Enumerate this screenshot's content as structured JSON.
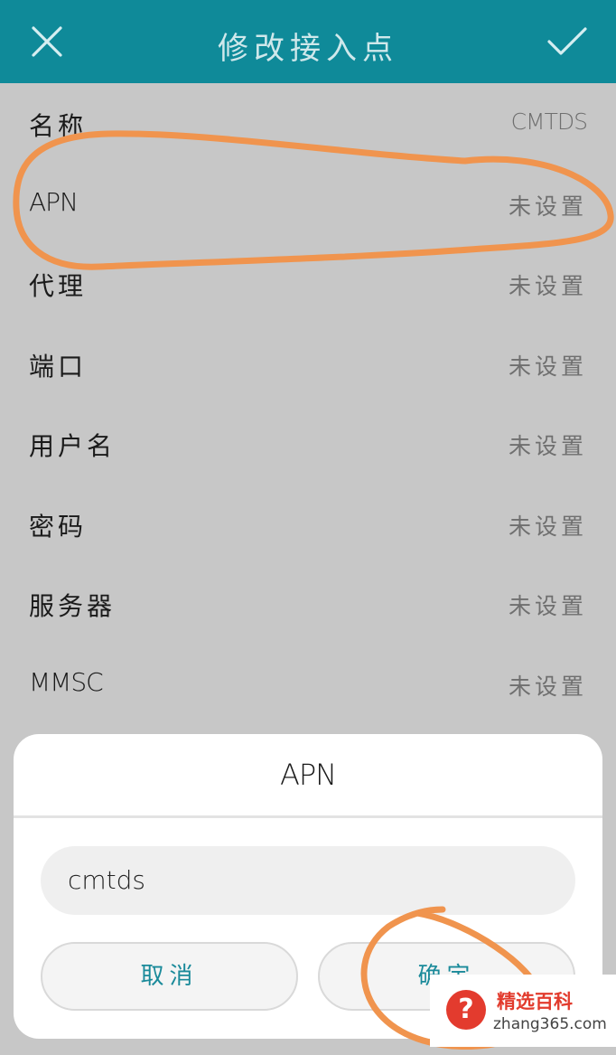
{
  "header": {
    "title": "修改接入点",
    "close_icon": "close-icon",
    "confirm_icon": "check-icon",
    "background": "#0f8a99"
  },
  "settings": {
    "rows": [
      {
        "label": "名称",
        "value": "CMTDS"
      },
      {
        "label": "APN",
        "value": "未设置"
      },
      {
        "label": "代理",
        "value": "未设置"
      },
      {
        "label": "端口",
        "value": "未设置"
      },
      {
        "label": "用户名",
        "value": "未设置"
      },
      {
        "label": "密码",
        "value": "未设置"
      },
      {
        "label": "服务器",
        "value": "未设置"
      },
      {
        "label": "MMSC",
        "value": "未设置"
      }
    ]
  },
  "dialog": {
    "title": "APN",
    "input_value": "cmtds",
    "cancel_label": "取消",
    "ok_label": "确定"
  },
  "watermark": {
    "brand": "精选百科",
    "site": "zhang365.com"
  },
  "colors": {
    "accent": "#0f8a99",
    "annotation": "#f0944e",
    "dialog_button_text": "#1a8a9a"
  }
}
